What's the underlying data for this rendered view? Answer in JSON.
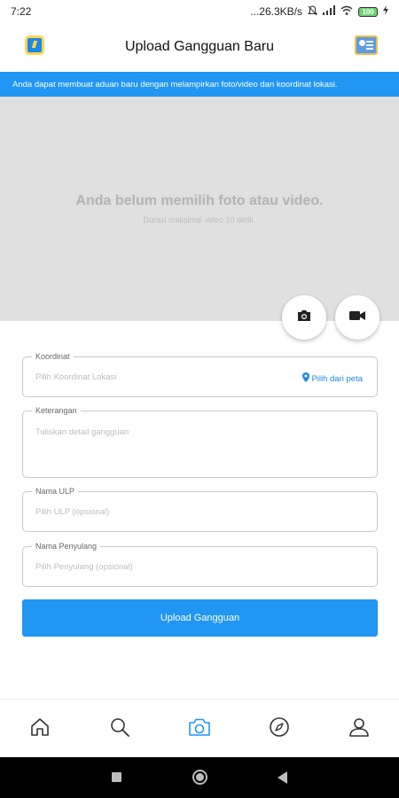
{
  "status_bar": {
    "time": "7:22",
    "network_speed": "...26.3KB/s",
    "battery": "100"
  },
  "header": {
    "title": "Upload Gangguan Baru",
    "logo_icon": "app-logo-icon",
    "right_icon": "id-card-icon"
  },
  "banner": {
    "text": "Anda dapat membuat aduan baru dengan melampirkan foto/video dan koordinat lokasi.",
    "color": "#2196f3"
  },
  "media": {
    "empty_title": "Anda belum memilih foto atau video.",
    "empty_subtitle": "Durasi maksimal video 10 detik.",
    "photo_icon": "camera-icon",
    "video_icon": "video-camera-icon"
  },
  "form": {
    "koordinat": {
      "label": "Koordinat",
      "placeholder": "Pilih Koordinat Lokasi",
      "map_pick_label": "Pilih dari peta"
    },
    "keterangan": {
      "label": "Keterangan",
      "placeholder": "Tuliskan detail gangguan"
    },
    "ulp": {
      "label": "Nama ULP",
      "placeholder": "Pilih ULP (opsional)"
    },
    "penyulang": {
      "label": "Nama Penyulang",
      "placeholder": "Pilih Penyulang (opsional)"
    },
    "submit_label": "Upload Gangguan"
  },
  "bottom_nav": {
    "items": [
      {
        "icon": "home-icon",
        "active": false
      },
      {
        "icon": "search-icon",
        "active": false
      },
      {
        "icon": "camera-icon",
        "active": true
      },
      {
        "icon": "compass-icon",
        "active": false
      },
      {
        "icon": "user-icon",
        "active": false
      }
    ],
    "active_color": "#2196f3"
  }
}
